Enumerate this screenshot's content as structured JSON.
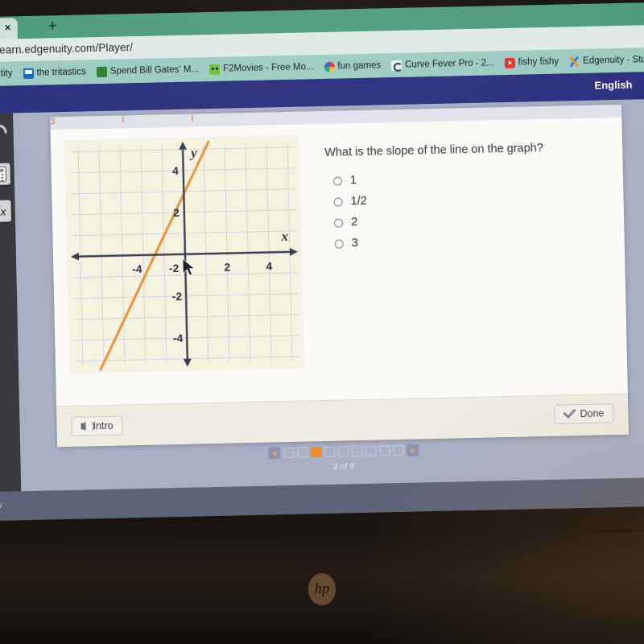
{
  "browser": {
    "tab_close_glyph": "×",
    "new_tab_glyph": "+",
    "url": "ore.learn.edgenuity.com/Player/",
    "bookmarks": [
      {
        "label": "entity",
        "icon": "generic-bookmark-icon"
      },
      {
        "label": "the tritastics",
        "icon": "blue-grid-icon"
      },
      {
        "label": "Spend Bill Gates' M...",
        "icon": "money-icon"
      },
      {
        "label": "F2Movies - Free Mo...",
        "icon": "frog-icon"
      },
      {
        "label": "fun games",
        "icon": "chrome-circle-icon"
      },
      {
        "label": "Curve Fever Pro - 2...",
        "icon": "curve-fever-icon"
      },
      {
        "label": "fishy fishy",
        "icon": "youtube-icon"
      },
      {
        "label": "Edgenuity - Stu",
        "icon": "edgenuity-x-icon"
      }
    ]
  },
  "app_header": {
    "left_fragment": "3",
    "language": "English"
  },
  "tool_rail": [
    {
      "name": "headset-icon",
      "label": "Headset"
    },
    {
      "name": "calculator-icon",
      "label": "Calculator"
    },
    {
      "name": "sqrt-icon",
      "label": "√x"
    }
  ],
  "lesson": {
    "question": "What is the slope of the line on the graph?",
    "options": [
      {
        "label": "1",
        "selected": false
      },
      {
        "label": "1/2",
        "selected": false
      },
      {
        "label": "2",
        "selected": false
      },
      {
        "label": "3",
        "selected": false
      }
    ],
    "intro_button": "Intro",
    "done_button": "Done"
  },
  "pager": {
    "prev_glyph": "◀",
    "next_glyph": "▶",
    "total": 9,
    "current": 3,
    "label": "3 of 9"
  },
  "taskbar": {
    "text": "ty"
  },
  "hardware": {
    "brand": "hp"
  },
  "colors": {
    "accent_orange": "#ef8b2c",
    "line_orange": "#e8943f",
    "app_navy": "#2b2f7e",
    "bookmark_bar": "#9ccbc2",
    "tab_strip": "#4e9c7c",
    "graph_paper": "#f6f2e0",
    "axis": "#3a3f52"
  },
  "chart_data": {
    "type": "line",
    "title": "",
    "xlabel": "x",
    "ylabel": "y",
    "xlim": [
      -5.5,
      5.5
    ],
    "ylim": [
      -5.5,
      5.5
    ],
    "xticks": [
      -4,
      -2,
      2,
      4
    ],
    "yticks": [
      -4,
      -2,
      2,
      4
    ],
    "xtick_labels": [
      "-4",
      "-2",
      "2",
      "4"
    ],
    "ytick_labels": [
      "-4",
      "-2",
      "2",
      "4"
    ],
    "grid": true,
    "grid_step": 1,
    "series": [
      {
        "name": "line",
        "slope": 2,
        "intercept": 3,
        "x_intercept": -1.5,
        "points": [
          [
            -4.2,
            -5.4
          ],
          [
            1.2,
            5.4
          ]
        ],
        "color": "#e8943f"
      }
    ],
    "cursor": {
      "x": -0.1,
      "y": -0.25,
      "glyph": "arrow-pointer"
    }
  }
}
